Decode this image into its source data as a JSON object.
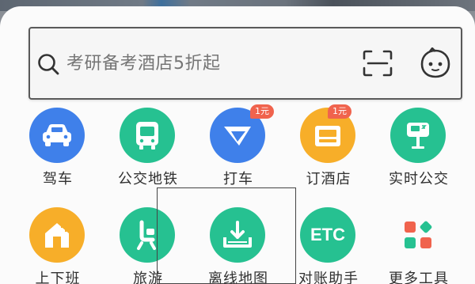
{
  "search": {
    "placeholder": "考研备考酒店5折起"
  },
  "icons": {
    "search": "search-icon",
    "scan": "scan-icon",
    "assistant": "assistant-icon"
  },
  "tools": [
    {
      "label": "驾车",
      "icon": "car-icon",
      "color": "#3f80ea"
    },
    {
      "label": "公交地铁",
      "icon": "bus-icon",
      "color": "#26c191"
    },
    {
      "label": "打车",
      "icon": "taxi-icon",
      "color": "#3f80ea",
      "badge": "1元"
    },
    {
      "label": "订酒店",
      "icon": "hotel-icon",
      "color": "#f7ae29",
      "badge": "1元"
    },
    {
      "label": "实时公交",
      "icon": "realtime-bus-icon",
      "color": "#26c191"
    },
    {
      "label": "上下班",
      "icon": "commute-icon",
      "color": "#f7ae29"
    },
    {
      "label": "旅游",
      "icon": "travel-icon",
      "color": "#26c191"
    },
    {
      "label": "离线地图",
      "icon": "offline-map-icon",
      "color": "#26c191"
    },
    {
      "label": "ETC",
      "icon": "etc-icon",
      "color": "#26c191",
      "sublabel": "对账助手"
    },
    {
      "label": "更多工具",
      "icon": "more-tools-icon",
      "color": "#f0634d"
    }
  ],
  "labels": {
    "t0": "驾车",
    "t1": "公交地铁",
    "t2": "打车",
    "t3": "订酒店",
    "t4": "实时公交",
    "t5": "上下班",
    "t6": "旅游",
    "t7": "离线地图",
    "t8": "对账助手",
    "t9": "更多工具",
    "etc_text": "ETC",
    "badge_taxi": "1元",
    "badge_hotel": "1元"
  }
}
